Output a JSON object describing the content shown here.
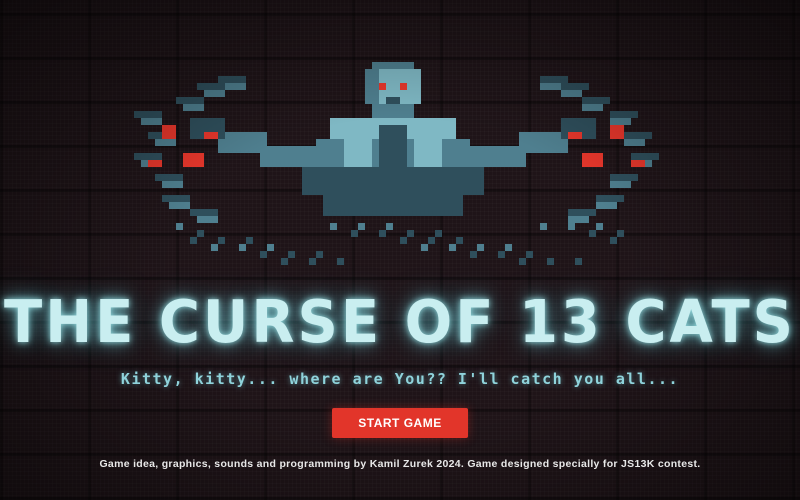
{
  "game": {
    "title": "THE CURSE OF 13 CATS",
    "subtitle": "Kitty, kitty... where are You?? I'll catch you all...",
    "start_label": "START GAME",
    "credits": "Game idea, graphics, sounds and programming by Kamil Zurek 2024. Game designed specially for JS13K contest."
  },
  "colors": {
    "background": "#1f1418",
    "title_glow": "#c9eef0",
    "subtitle": "#8fd3db",
    "button": "#e2352a",
    "monster_light": "#7fb8c4",
    "monster_mid": "#4f7f8f",
    "monster_dark": "#2f4f5c",
    "monster_blood": "#e8372c"
  },
  "art": {
    "monster": "pixel-art-zombie-reaching"
  }
}
